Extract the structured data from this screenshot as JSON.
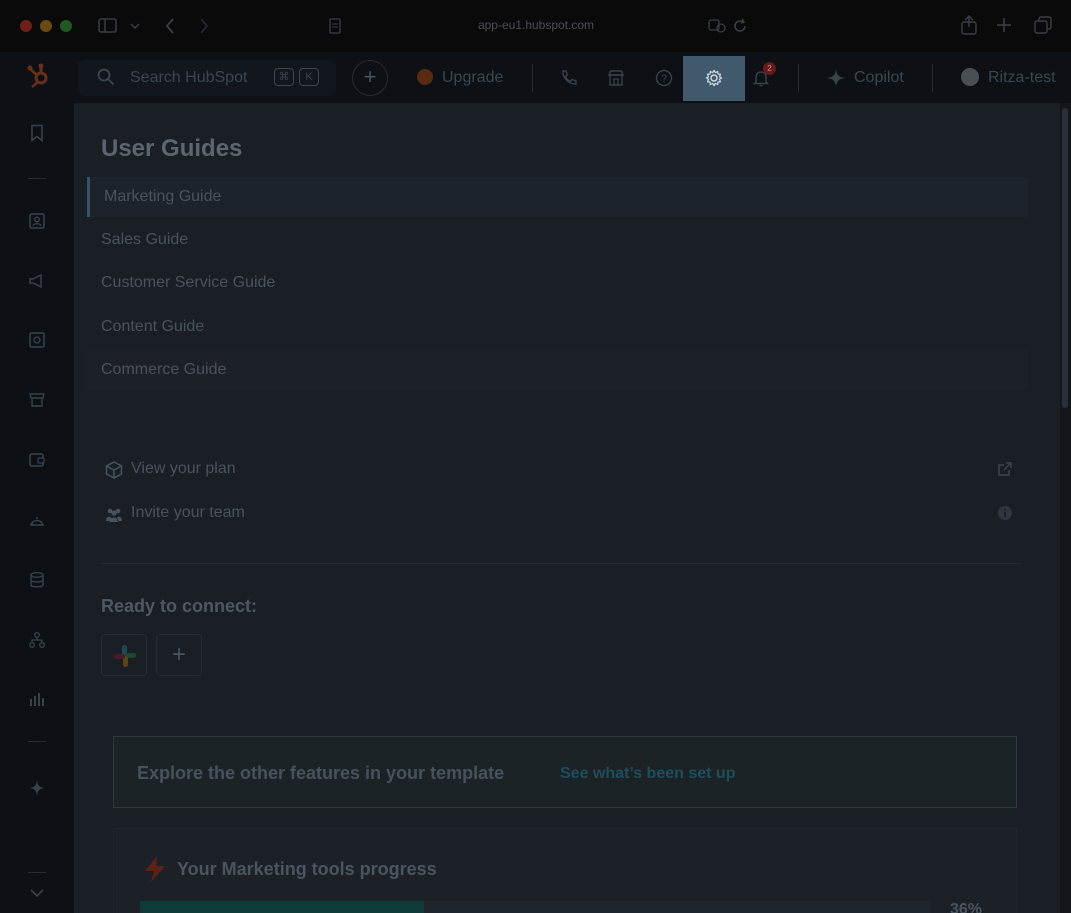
{
  "browser": {
    "url": "app-eu1.hubspot.com"
  },
  "topnav": {
    "search_placeholder": "Search HubSpot",
    "shortcut_keys": [
      "⌘",
      "K"
    ],
    "upgrade_label": "Upgrade",
    "notification_count": "2",
    "copilot_label": "Copilot",
    "account_label": "Ritza-test"
  },
  "guides": {
    "title": "User Guides",
    "items": [
      {
        "label": "Marketing Guide"
      },
      {
        "label": "Sales Guide"
      },
      {
        "label": "Customer Service Guide"
      },
      {
        "label": "Content Guide"
      },
      {
        "label": "Commerce Guide"
      }
    ]
  },
  "utilities": {
    "view_plan_label": "View your plan",
    "invite_team_label": "Invite your team"
  },
  "connect": {
    "title": "Ready to connect:"
  },
  "explore": {
    "text": "Explore the other features in your template",
    "link": "See what’s been set up"
  },
  "progress": {
    "title": "Your Marketing tools progress",
    "percent_label": "36%",
    "percent_value": 0.36
  },
  "colors": {
    "active_setting": "#40596d",
    "progress_fill": "#0e3b37"
  }
}
